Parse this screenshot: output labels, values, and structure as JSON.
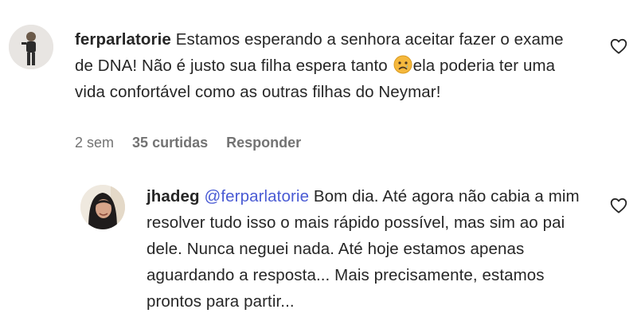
{
  "comments": [
    {
      "username": "ferparlatorie",
      "text_before_emoji": "Estamos esperando a senhora aceitar fazer o exame de DNA! Não é justo sua filha espera tanto",
      "emoji": "sad-face-emoji",
      "text_after_emoji": "ela poderia ter uma vida confortável como as outras filhas do Neymar!",
      "time": "2 sem",
      "likes": "35 curtidas",
      "reply_label": "Responder"
    },
    {
      "username": "jhadeg",
      "mention": "@ferparlatorie",
      "text": "Bom dia. Até agora não cabia a mim resolver tudo isso o mais rápido possível, mas sim ao pai dele. Nunca neguei nada. Até hoje estamos apenas aguardando a resposta... Mais precisamente, estamos prontos para partir..."
    }
  ],
  "colors": {
    "text": "#262626",
    "meta": "#737373",
    "mention": "#4a5bd4"
  },
  "icons": {
    "like": "heart-outline-icon"
  }
}
